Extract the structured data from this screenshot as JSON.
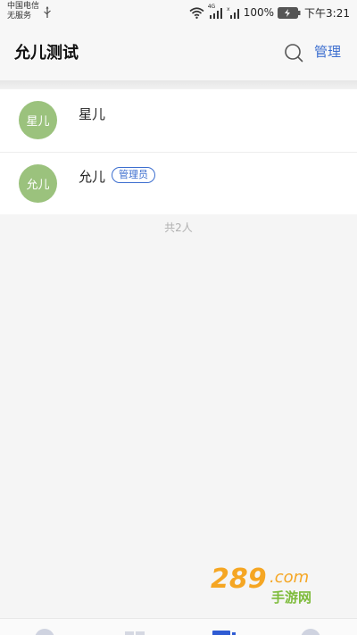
{
  "status_bar": {
    "carrier_line1": "中国电信",
    "carrier_line2": "无服务",
    "battery_percent": "100%",
    "time": "下午3:21",
    "network_badge": "4G"
  },
  "header": {
    "title": "允儿测试",
    "manage_label": "管理"
  },
  "members": [
    {
      "avatar_text": "星儿",
      "name": "星儿",
      "badge": ""
    },
    {
      "avatar_text": "允儿",
      "name": "允儿",
      "badge": "管理员"
    }
  ],
  "member_count": "共2人",
  "colors": {
    "accent": "#3c6ecf",
    "avatar": "#9bc27d",
    "background": "#f5f5f5"
  },
  "watermark": {
    "text_top": "289",
    "text_com": ".com",
    "text_cn": "手游网"
  }
}
